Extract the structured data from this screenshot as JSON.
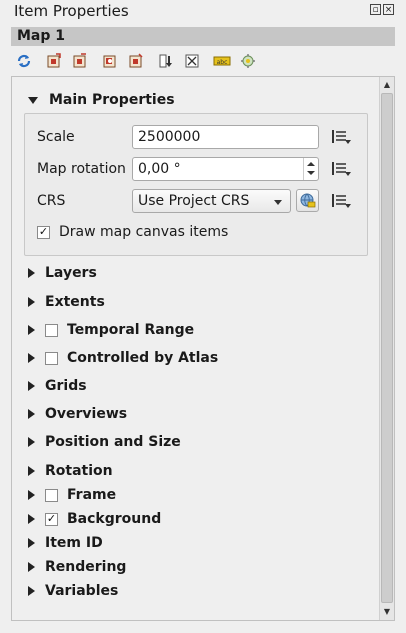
{
  "window": {
    "title": "Item Properties"
  },
  "item": {
    "name": "Map 1"
  },
  "toolbar": {
    "icons": [
      "refresh-icon",
      "update-extent-icon",
      "set-extent-icon",
      "view-extent-icon",
      "set-view-extent-icon",
      "lock-layers-icon",
      "lock-styles-icon",
      "label-icon",
      "atlas-icon"
    ]
  },
  "main_properties": {
    "header": "Main Properties",
    "scale": {
      "label": "Scale",
      "value": "2500000"
    },
    "rotation": {
      "label": "Map rotation",
      "value": "0,00 °"
    },
    "crs": {
      "label": "CRS",
      "value": "Use Project CRS"
    },
    "draw_canvas_items": {
      "label": "Draw map canvas items",
      "checked": true
    }
  },
  "sections": [
    {
      "label": "Layers"
    },
    {
      "label": "Extents"
    },
    {
      "label": "Temporal Range",
      "checkbox": true,
      "checked": false
    },
    {
      "label": "Controlled by Atlas",
      "checkbox": true,
      "checked": false
    },
    {
      "label": "Grids"
    },
    {
      "label": "Overviews"
    },
    {
      "label": "Position and Size"
    },
    {
      "label": "Rotation"
    },
    {
      "label": "Frame",
      "checkbox": true,
      "checked": false
    },
    {
      "label": "Background",
      "checkbox": true,
      "checked": true
    },
    {
      "label": "Item ID"
    },
    {
      "label": "Rendering"
    },
    {
      "label": "Variables"
    }
  ],
  "marks": {
    "checked": "✓",
    "unchecked": ""
  },
  "colors": {
    "header_bg": "#c6c6c6",
    "refresh_blue": "#2a6fc4",
    "icon_red": "#c0392b",
    "icon_yellow": "#e6c21c"
  }
}
